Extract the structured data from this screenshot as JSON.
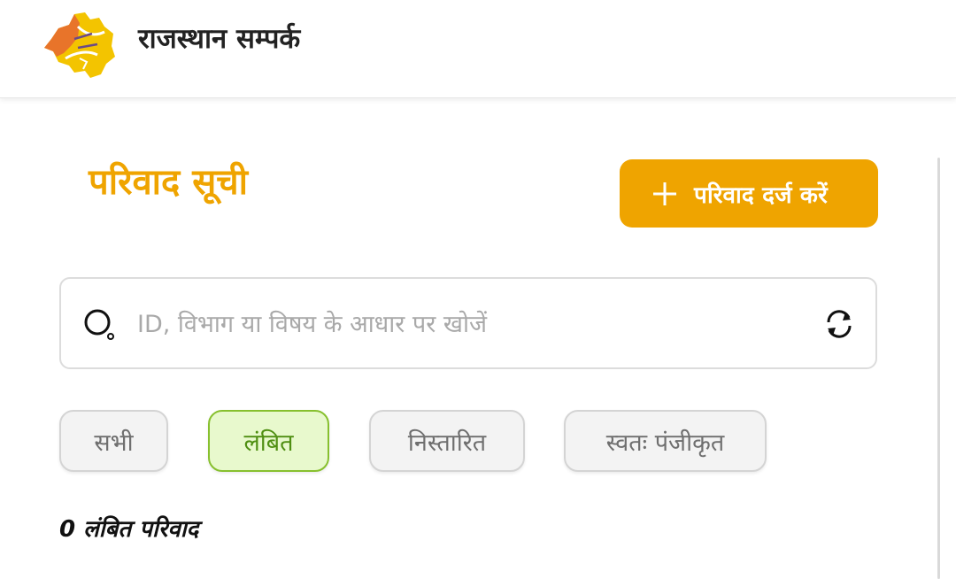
{
  "app": {
    "title": "राजस्थान सम्पर्क",
    "logo_icon": "rajasthan-map-logo"
  },
  "page": {
    "title": "परिवाद सूची",
    "title_color": "#efa400"
  },
  "actions": {
    "add_label": "परिवाद दर्ज करें",
    "add_icon": "plus-icon",
    "accent_color": "#efa400"
  },
  "search": {
    "value": "",
    "placeholder": "ID, विभाग या विषय के आधार पर खोजें",
    "search_icon": "search-icon",
    "refresh_icon": "refresh-icon"
  },
  "filters": [
    {
      "label": "सभी",
      "active": false
    },
    {
      "label": "लंबित",
      "active": true
    },
    {
      "label": "निस्तारित",
      "active": false
    },
    {
      "label": "स्वतः पंजीकृत",
      "active": false
    }
  ],
  "results": {
    "count_label": "0 लंबित परिवाद"
  },
  "colors": {
    "active_chip_bg": "#e8f9cd",
    "active_chip_border": "#87c02e",
    "active_chip_text": "#4f8f12"
  }
}
